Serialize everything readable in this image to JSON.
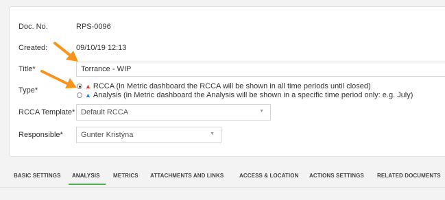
{
  "form": {
    "doc_no_label": "Doc. No.",
    "doc_no_value": "RPS-0096",
    "created_label": "Created:",
    "created_value": "09/10/19 12:13",
    "title_label": "Title*",
    "title_value": "Torrance - WIP",
    "type_label": "Type*",
    "type_options": [
      {
        "label": "RCCA (in Metric dashboard the RCCA will be shown in all time periods until closed)",
        "checked": true,
        "icon": "red-triangle-icon",
        "color": "#e53935"
      },
      {
        "label": "Analysis (in Metric dashboard the Analysis will be shown in a specific time period only: e.g. July)",
        "checked": false,
        "icon": "blue-triangle-icon",
        "color": "#1e88e5"
      }
    ],
    "template_label": "RCCA Template*",
    "template_value": "Default RCCA",
    "responsible_label": "Responsible*",
    "responsible_value": "Gunter Kristýna"
  },
  "tabs": [
    {
      "label": "BASIC SETTINGS",
      "active": false
    },
    {
      "label": "ANALYSIS",
      "active": true
    },
    {
      "label": "METRICS",
      "active": false
    },
    {
      "label": "ATTACHMENTS AND LINKS",
      "active": false
    },
    {
      "label": "ACCESS & LOCATION",
      "active": false
    },
    {
      "label": "ACTIONS SETTINGS",
      "active": false
    },
    {
      "label": "RELATED DOCUMENTS",
      "active": false
    }
  ],
  "colors": {
    "accent": "#4caf50",
    "annotation_arrow": "#f7941d"
  }
}
